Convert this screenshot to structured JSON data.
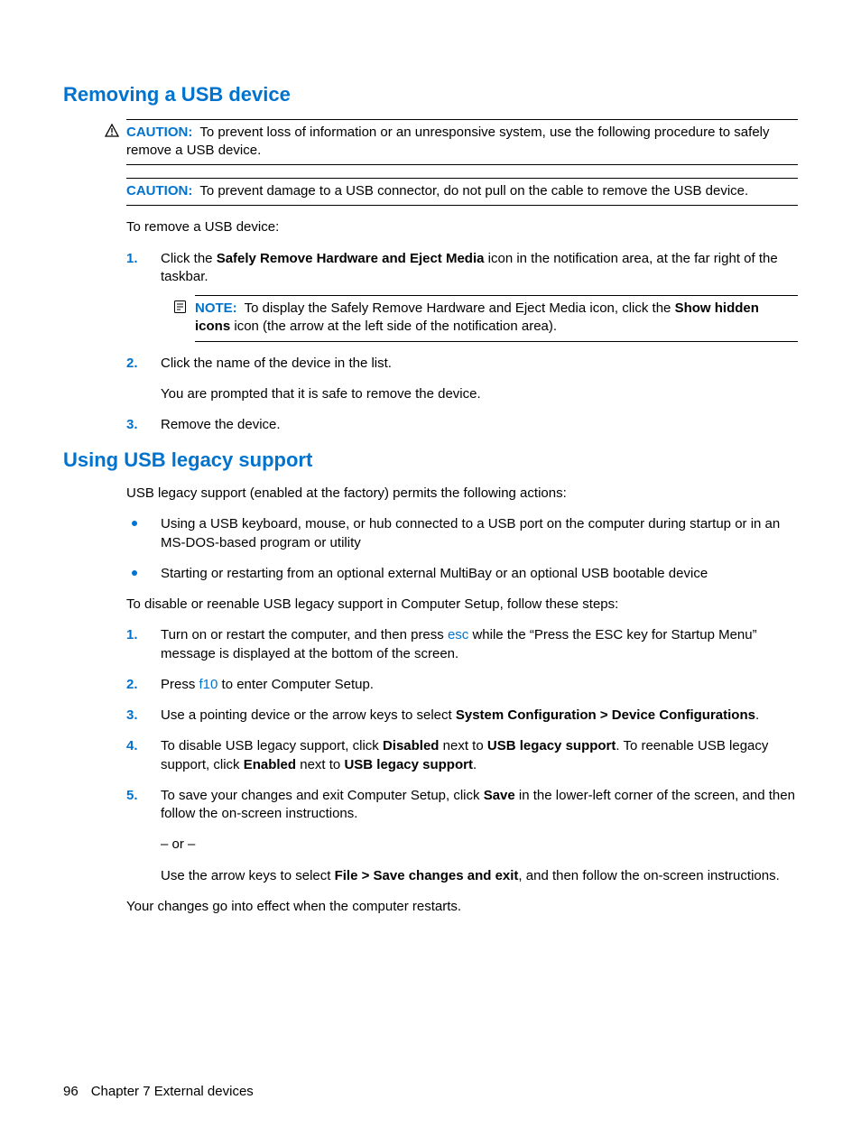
{
  "section1": {
    "title": "Removing a USB device",
    "caution1_label": "CAUTION:",
    "caution1_text": "To prevent loss of information or an unresponsive system, use the following procedure to safely remove a USB device.",
    "caution2_label": "CAUTION:",
    "caution2_text": "To prevent damage to a USB connector, do not pull on the cable to remove the USB device.",
    "intro": "To remove a USB device:",
    "step1_num": "1.",
    "step1_a": "Click the ",
    "step1_b": "Safely Remove Hardware and Eject Media",
    "step1_c": " icon in the notification area, at the far right of the taskbar.",
    "note_label": "NOTE:",
    "note_a": "To display the Safely Remove Hardware and Eject Media icon, click the ",
    "note_b": "Show hidden icons",
    "note_c": " icon (the arrow at the left side of the notification area).",
    "step2_num": "2.",
    "step2_text": "Click the name of the device in the list.",
    "step2_sub": "You are prompted that it is safe to remove the device.",
    "step3_num": "3.",
    "step3_text": "Remove the device."
  },
  "section2": {
    "title": "Using USB legacy support",
    "intro1": "USB legacy support (enabled at the factory) permits the following actions:",
    "bullet1": "Using a USB keyboard, mouse, or hub connected to a USB port on the computer during startup or in an MS-DOS-based program or utility",
    "bullet2": "Starting or restarting from an optional external MultiBay or an optional USB bootable device",
    "intro2": "To disable or reenable USB legacy support in Computer Setup, follow these steps:",
    "step1_num": "1.",
    "step1_a": "Turn on or restart the computer, and then press ",
    "step1_key": "esc",
    "step1_b": " while the “Press the ESC key for Startup Menu” message is displayed at the bottom of the screen.",
    "step2_num": "2.",
    "step2_a": "Press ",
    "step2_key": "f10",
    "step2_b": " to enter Computer Setup.",
    "step3_num": "3.",
    "step3_a": "Use a pointing device or the arrow keys to select ",
    "step3_b": "System Configuration > Device Configurations",
    "step3_c": ".",
    "step4_num": "4.",
    "step4_a": "To disable USB legacy support, click ",
    "step4_b": "Disabled",
    "step4_c": " next to ",
    "step4_d": "USB legacy support",
    "step4_e": ". To reenable USB legacy support, click ",
    "step4_f": "Enabled",
    "step4_g": " next to ",
    "step4_h": "USB legacy support",
    "step4_i": ".",
    "step5_num": "5.",
    "step5_a": "To save your changes and exit Computer Setup, click ",
    "step5_b": "Save",
    "step5_c": " in the lower-left corner of the screen, and then follow the on-screen instructions.",
    "step5_or": "– or –",
    "step5_d": "Use the arrow keys to select ",
    "step5_e": "File > Save changes and exit",
    "step5_f": ", and then follow the on-screen instructions.",
    "outro": "Your changes go into effect when the computer restarts."
  },
  "footer": {
    "page": "96",
    "chapter": "Chapter 7   External devices"
  }
}
